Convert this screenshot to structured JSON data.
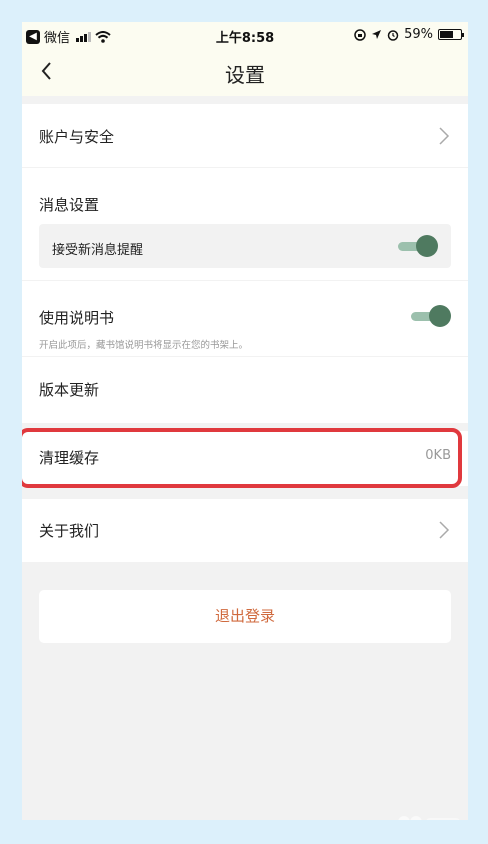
{
  "status_bar": {
    "app_back": "微信",
    "time": "上午8:58",
    "battery": "59%"
  },
  "nav": {
    "title": "设置"
  },
  "settings": {
    "account": "账户与安全",
    "message_settings": "消息设置",
    "receive_new_messages": "接受新消息提醒",
    "manual": "使用说明书",
    "manual_hint": "开启此项后，藏书馆说明书将显示在您的书架上。",
    "version_update": "版本更新",
    "clear_cache": "清理缓存",
    "cache_size": "0KB",
    "about_us": "关于我们",
    "logout": "退出登录"
  },
  "toggles": {
    "receive_new_messages": true,
    "manual": true
  },
  "colors": {
    "toggle_on": "#4f7a60",
    "toggle_track": "#9cc0ad",
    "highlight": "#e0393e",
    "logout_text": "#d06a3e"
  }
}
